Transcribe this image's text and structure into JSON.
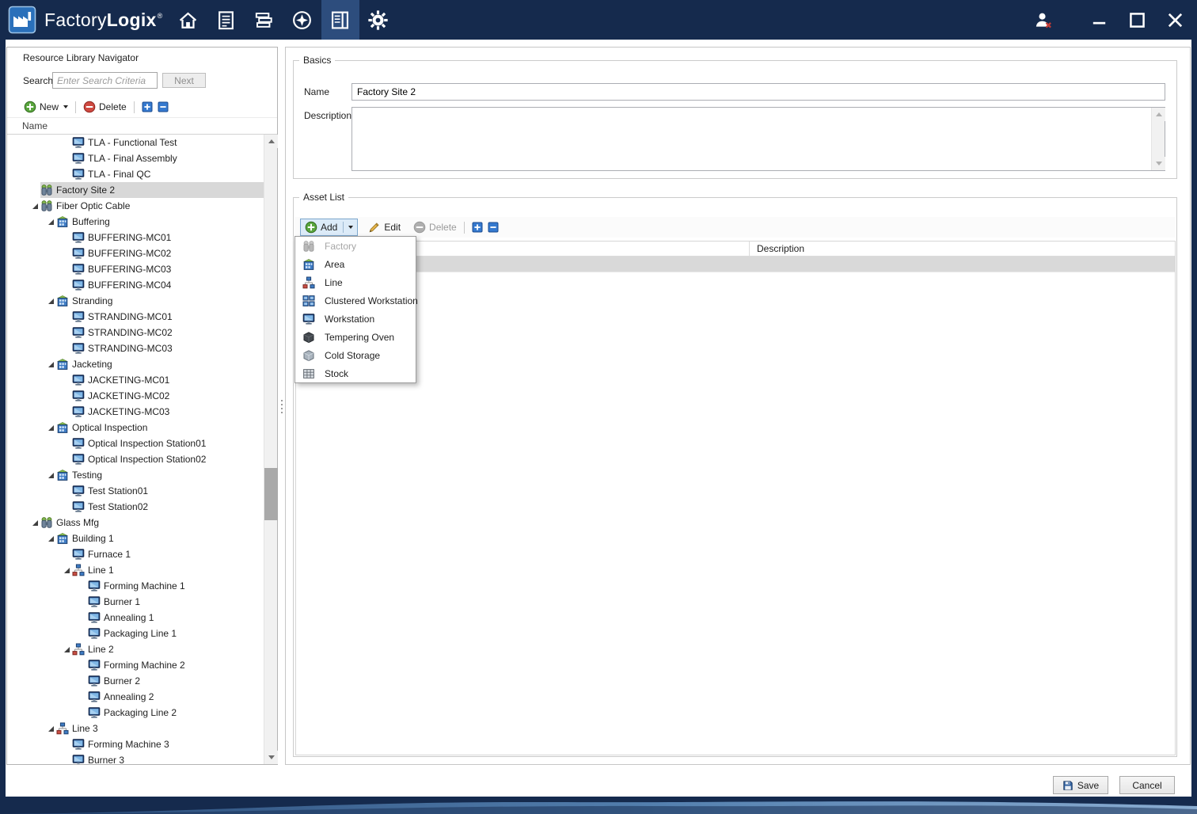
{
  "titlebar": {
    "app_name_light": "Factory",
    "app_name_bold": "Logix",
    "registered_mark": "®",
    "nav_icons": [
      {
        "name": "home"
      },
      {
        "name": "clipboard"
      },
      {
        "name": "books"
      },
      {
        "name": "compass"
      },
      {
        "name": "doc-panel",
        "active": true
      },
      {
        "name": "gear"
      }
    ],
    "window_icons": [
      "user-logout",
      "minimize",
      "maximize",
      "close"
    ]
  },
  "left_panel": {
    "title": "Resource Library Navigator",
    "search_label": "Search",
    "search_placeholder": "Enter Search Criteria",
    "search_value": "",
    "next_button": "Next",
    "new_button": "New",
    "delete_button": "Delete",
    "column_header": "Name",
    "tree": [
      {
        "label": "TLA - Functional Test",
        "level": 2,
        "icon": "workstation"
      },
      {
        "label": "TLA - Final Assembly",
        "level": 2,
        "icon": "workstation"
      },
      {
        "label": "TLA - Final QC",
        "level": 2,
        "icon": "workstation"
      },
      {
        "label": "Factory Site 2",
        "level": 0,
        "icon": "factory",
        "selected": true
      },
      {
        "label": "Fiber Optic Cable",
        "level": 0,
        "icon": "factory",
        "expanded": true
      },
      {
        "label": "Buffering",
        "level": 1,
        "icon": "area",
        "expanded": true
      },
      {
        "label": "BUFFERING-MC01",
        "level": 2,
        "icon": "workstation"
      },
      {
        "label": "BUFFERING-MC02",
        "level": 2,
        "icon": "workstation"
      },
      {
        "label": "BUFFERING-MC03",
        "level": 2,
        "icon": "workstation"
      },
      {
        "label": "BUFFERING-MC04",
        "level": 2,
        "icon": "workstation"
      },
      {
        "label": "Stranding",
        "level": 1,
        "icon": "area",
        "expanded": true
      },
      {
        "label": "STRANDING-MC01",
        "level": 2,
        "icon": "workstation"
      },
      {
        "label": "STRANDING-MC02",
        "level": 2,
        "icon": "workstation"
      },
      {
        "label": "STRANDING-MC03",
        "level": 2,
        "icon": "workstation"
      },
      {
        "label": "Jacketing",
        "level": 1,
        "icon": "area",
        "expanded": true
      },
      {
        "label": "JACKETING-MC01",
        "level": 2,
        "icon": "workstation"
      },
      {
        "label": "JACKETING-MC02",
        "level": 2,
        "icon": "workstation"
      },
      {
        "label": "JACKETING-MC03",
        "level": 2,
        "icon": "workstation"
      },
      {
        "label": "Optical Inspection",
        "level": 1,
        "icon": "area",
        "expanded": true
      },
      {
        "label": "Optical Inspection Station01",
        "level": 2,
        "icon": "workstation"
      },
      {
        "label": "Optical Inspection Station02",
        "level": 2,
        "icon": "workstation"
      },
      {
        "label": "Testing",
        "level": 1,
        "icon": "area",
        "expanded": true
      },
      {
        "label": "Test Station01",
        "level": 2,
        "icon": "workstation"
      },
      {
        "label": "Test Station02",
        "level": 2,
        "icon": "workstation"
      },
      {
        "label": "Glass Mfg",
        "level": 0,
        "icon": "factory",
        "expanded": true
      },
      {
        "label": "Building 1",
        "level": 1,
        "icon": "area",
        "expanded": true
      },
      {
        "label": "Furnace 1",
        "level": 2,
        "icon": "workstation"
      },
      {
        "label": "Line 1",
        "level": 2,
        "icon": "line",
        "expanded": true
      },
      {
        "label": "Forming Machine 1",
        "level": 3,
        "icon": "workstation"
      },
      {
        "label": "Burner 1",
        "level": 3,
        "icon": "workstation"
      },
      {
        "label": "Annealing 1",
        "level": 3,
        "icon": "workstation"
      },
      {
        "label": "Packaging Line 1",
        "level": 3,
        "icon": "workstation"
      },
      {
        "label": "Line 2",
        "level": 2,
        "icon": "line",
        "expanded": true
      },
      {
        "label": "Forming Machine 2",
        "level": 3,
        "icon": "workstation"
      },
      {
        "label": "Burner 2",
        "level": 3,
        "icon": "workstation"
      },
      {
        "label": "Annealing 2",
        "level": 3,
        "icon": "workstation"
      },
      {
        "label": "Packaging Line 2",
        "level": 3,
        "icon": "workstation"
      },
      {
        "label": "Line 3",
        "level": 1,
        "icon": "line",
        "expanded": true
      },
      {
        "label": "Forming Machine 3",
        "level": 2,
        "icon": "workstation"
      },
      {
        "label": "Burner 3",
        "level": 2,
        "icon": "workstation"
      }
    ]
  },
  "main": {
    "basics": {
      "title": "Basics",
      "name_label": "Name",
      "name_value": "Factory Site 2",
      "description_label": "Description",
      "description_value": ""
    },
    "asset_list": {
      "title": "Asset List",
      "add_button": "Add",
      "edit_button": "Edit",
      "delete_button": "Delete",
      "description_column": "Description",
      "menu": [
        {
          "label": "Factory",
          "icon": "factory",
          "disabled": true
        },
        {
          "label": "Area",
          "icon": "area"
        },
        {
          "label": "Line",
          "icon": "line"
        },
        {
          "label": "Clustered Workstation",
          "icon": "clustered-workstation"
        },
        {
          "label": "Workstation",
          "icon": "workstation"
        },
        {
          "label": "Tempering Oven",
          "icon": "tempering-oven"
        },
        {
          "label": "Cold Storage",
          "icon": "cold-storage"
        },
        {
          "label": "Stock",
          "icon": "stock"
        }
      ]
    },
    "save_button": "Save",
    "cancel_button": "Cancel"
  },
  "colors": {
    "titlebar": "#152a4d",
    "nav_active": "#2d4d7d",
    "accent_green": "#5aa63e",
    "accent_red": "#cf4a41",
    "accent_blue": "#3579cf",
    "selection_gray": "#d8d8d8"
  }
}
